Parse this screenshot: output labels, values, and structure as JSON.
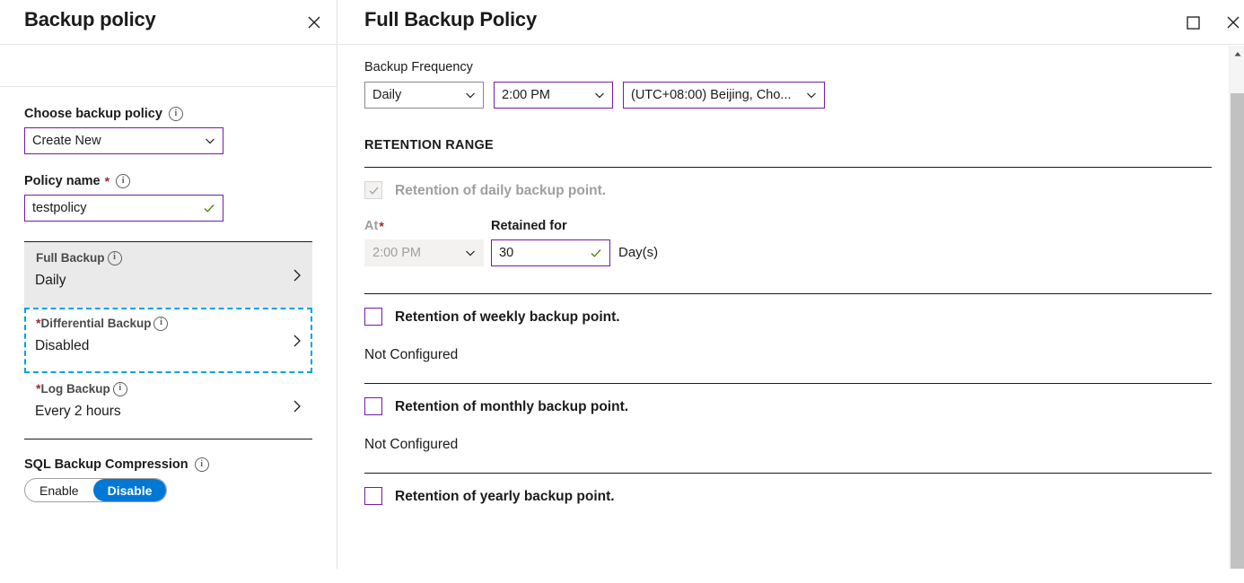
{
  "left_blade": {
    "title": "Backup policy",
    "close_icon": "close-icon",
    "choose_policy": {
      "label": "Choose backup policy",
      "info_icon": "info-icon",
      "value": "Create New"
    },
    "policy_name": {
      "label": "Policy name",
      "required_marker": "*",
      "info_icon": "info-icon",
      "value": "testpolicy",
      "validation_icon": "checkmark-icon"
    },
    "backup_cards": [
      {
        "title": "Full Backup",
        "required_marker": "",
        "value": "Daily",
        "state": "selected",
        "chevron_icon": "chevron-right-icon"
      },
      {
        "title": "Differential Backup",
        "required_marker": "*",
        "value": "Disabled",
        "state": "focused",
        "chevron_icon": "chevron-right-icon"
      },
      {
        "title": "Log Backup",
        "required_marker": "*",
        "value": "Every 2 hours",
        "state": "normal",
        "chevron_icon": "chevron-right-icon"
      }
    ],
    "compression": {
      "label": "SQL Backup Compression",
      "info_icon": "info-icon",
      "options": [
        "Enable",
        "Disable"
      ],
      "selected": "Disable"
    }
  },
  "right_blade": {
    "title": "Full Backup Policy",
    "maximize_icon": "maximize-icon",
    "close_icon": "close-icon",
    "backup_frequency": {
      "label": "Backup Frequency",
      "frequency": "Daily",
      "time": "2:00 PM",
      "timezone": "(UTC+08:00) Beijing, Cho..."
    },
    "retention_range_title": "RETENTION RANGE",
    "daily": {
      "checkbox_label": "Retention of daily backup point.",
      "checked": true,
      "disabled": true,
      "at_label": "At",
      "at_required_marker": "*",
      "at_value": "2:00 PM",
      "retained_label": "Retained for",
      "retained_value": "30",
      "retained_unit": "Day(s)",
      "validation_icon": "checkmark-icon"
    },
    "weekly": {
      "checkbox_label": "Retention of weekly backup point.",
      "checked": false,
      "status": "Not Configured"
    },
    "monthly": {
      "checkbox_label": "Retention of monthly backup point.",
      "checked": false,
      "status": "Not Configured"
    },
    "yearly": {
      "checkbox_label": "Retention of yearly backup point.",
      "checked": false
    },
    "scrollbar": {
      "up_arrow_icon": "scroll-up-arrow-icon"
    }
  },
  "colors": {
    "accent_blue": "#0078D4",
    "input_purple": "#7719AA",
    "focus_cyan": "#00A2E8",
    "required_red": "#A4262C",
    "validation_green": "#498205",
    "selected_card_bg": "#EAEAEA"
  }
}
